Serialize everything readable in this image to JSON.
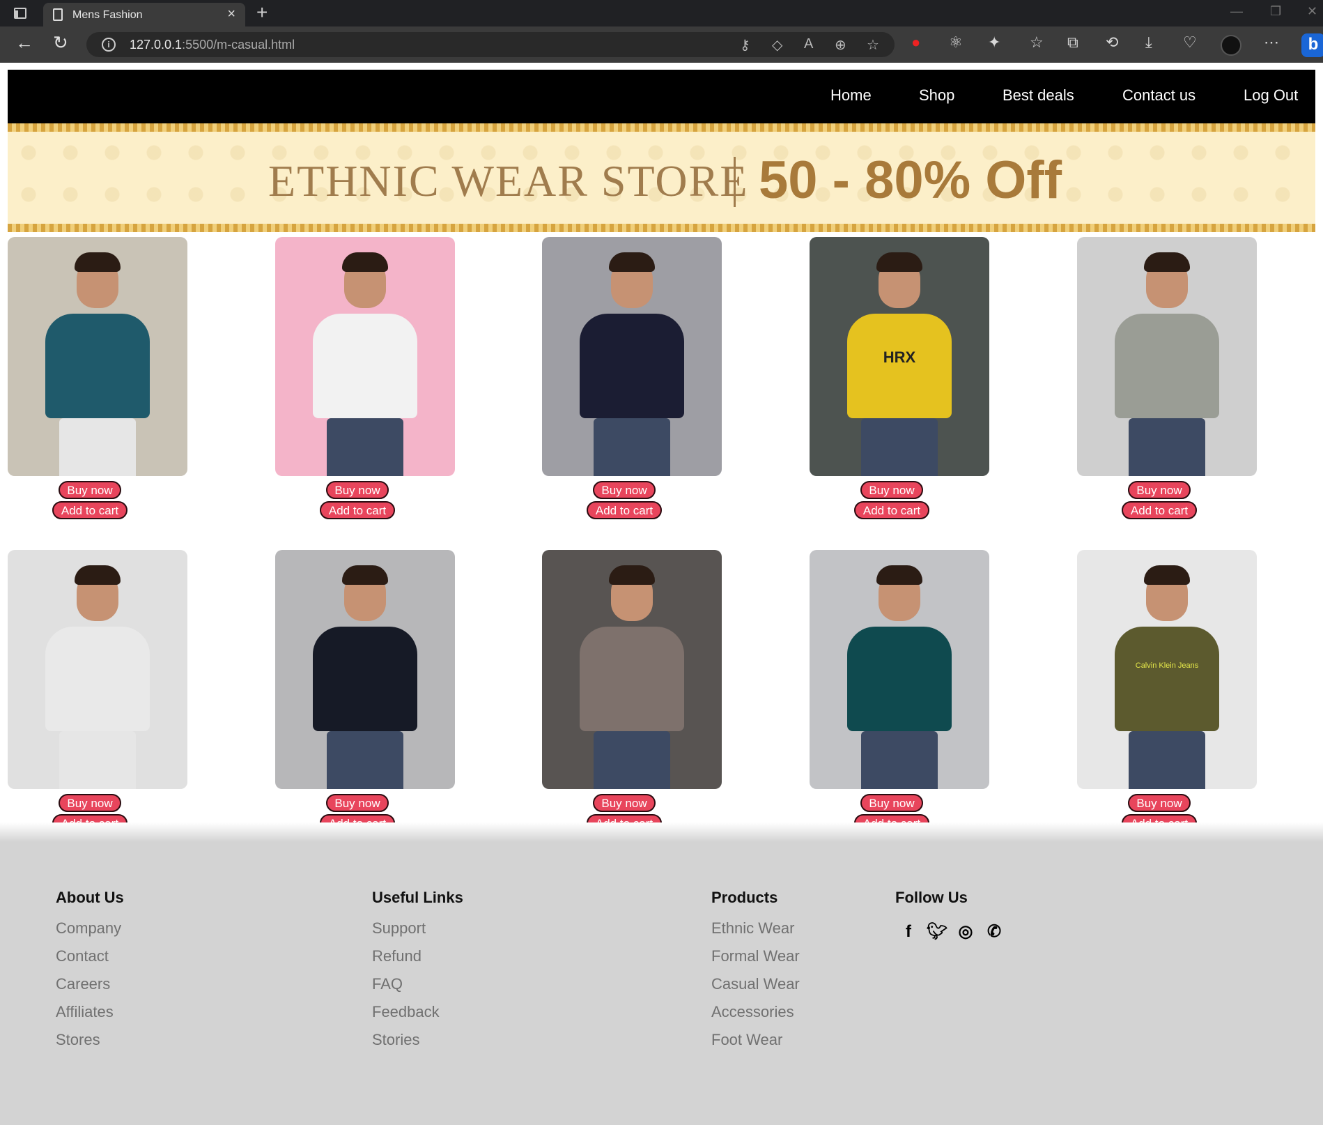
{
  "browser": {
    "tab_title": "Mens Fashion",
    "url_host": "127.0.0.1",
    "url_rest": ":5500/m-casual.html"
  },
  "nav": {
    "items": [
      "Home",
      "Shop",
      "Best deals",
      "Contact us",
      "Log Out"
    ]
  },
  "banner": {
    "store_text": "ETHNIC WEAR STORE",
    "offer_text": "50 - 80% Off",
    "bg_color": "#fcefc9",
    "text_color": "#a07c4d"
  },
  "products": {
    "buy_label": "Buy now",
    "cart_label": "Add to cart",
    "button_color": "#e8455c",
    "items": [
      {
        "photo": "man-on-stairs-striped-tee",
        "shirt_color": "#1f5a6b",
        "bg": "#c9c3b6",
        "print_text": ""
      },
      {
        "photo": "man-white-jacket-pink-bg",
        "shirt_color": "#f2f2f2",
        "bg": "#f4b4c9",
        "print_text": ""
      },
      {
        "photo": "man-navy-polo-sunglasses",
        "shirt_color": "#1b1d33",
        "bg": "#9e9ea4",
        "print_text": ""
      },
      {
        "photo": "man-yellow-hrx-tee",
        "shirt_color": "#e5c21f",
        "bg": "#4d5350",
        "print_text": "HRX"
      },
      {
        "photo": "man-grey-tee",
        "shirt_color": "#9a9d95",
        "bg": "#cfcfcf",
        "print_text": ""
      },
      {
        "photo": "man-striped-tee-white-shorts",
        "shirt_color": "#e9e9e9",
        "bg": "#e0e0e0",
        "print_text": ""
      },
      {
        "photo": "man-black-polo",
        "shirt_color": "#161a26",
        "bg": "#b7b7b9",
        "print_text": ""
      },
      {
        "photo": "man-grey-henley",
        "shirt_color": "#7e716c",
        "bg": "#585452",
        "print_text": ""
      },
      {
        "photo": "man-teal-long-sleeve",
        "shirt_color": "#0f4a4f",
        "bg": "#c2c3c6",
        "print_text": ""
      },
      {
        "photo": "man-olive-ck-tee",
        "shirt_color": "#5c5a2e",
        "bg": "#e7e7e7",
        "print_text": "Calvin Klein Jeans"
      }
    ]
  },
  "footer": {
    "columns": [
      {
        "title": "About Us",
        "links": [
          "Company",
          "Contact",
          "Careers",
          "Affiliates",
          "Stores"
        ]
      },
      {
        "title": "Useful Links",
        "links": [
          "Support",
          "Refund",
          "FAQ",
          "Feedback",
          "Stories"
        ]
      },
      {
        "title": "Products",
        "links": [
          "Ethnic Wear",
          "Formal Wear",
          "Casual Wear",
          "Accessories",
          "Foot Wear"
        ]
      }
    ],
    "follow_title": "Follow Us",
    "social_icons": [
      "facebook-icon",
      "twitter-icon",
      "instagram-icon",
      "whatsapp-icon"
    ]
  }
}
